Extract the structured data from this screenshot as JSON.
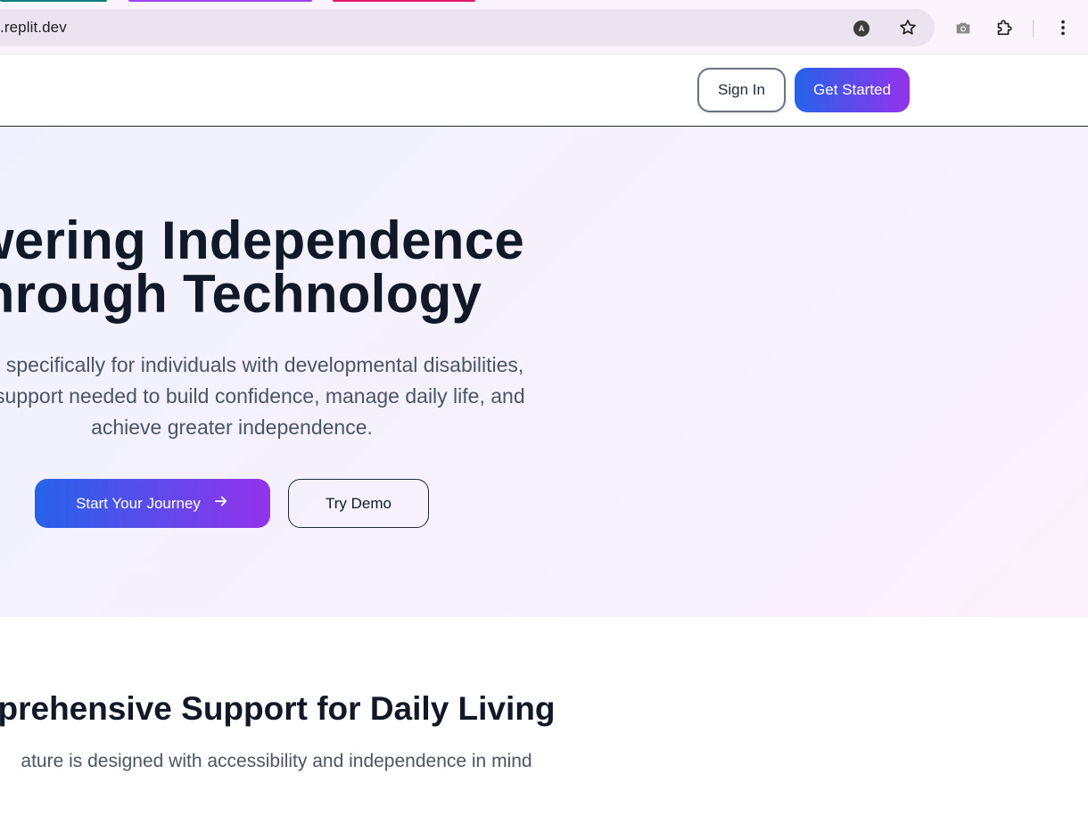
{
  "browser": {
    "url": ".replit.dev",
    "account_initial": "A",
    "icons": {
      "account": "account-icon",
      "bookmark": "star-icon",
      "screenshot": "camera-icon",
      "extensions": "puzzle-icon",
      "menu": "more-vert-icon"
    },
    "tab_colors": [
      "#0f7f7a",
      "#a142f4",
      "#e0166b"
    ]
  },
  "header": {
    "signin_label": "Sign In",
    "getstarted_label": "Get Started"
  },
  "hero": {
    "title_line1": "owering Independence",
    "title_line2": "hrough Technology",
    "subtitle_line1": "signed specifically for individuals with developmental disabilities,",
    "subtitle_line2": "s and support needed to build confidence, manage daily life, and",
    "subtitle_line3": "achieve greater independence.",
    "primary_cta": "Start Your Journey",
    "primary_cta_icon": "arrow-right-icon",
    "secondary_cta": "Try Demo"
  },
  "features": {
    "title": "prehensive Support for Daily Living",
    "subtitle": "ature is designed with accessibility and independence in mind"
  },
  "colors": {
    "brand_gradient_start": "#2563eb",
    "brand_gradient_end": "#9333ea",
    "heading": "#111827",
    "body_text": "#4b5563"
  }
}
